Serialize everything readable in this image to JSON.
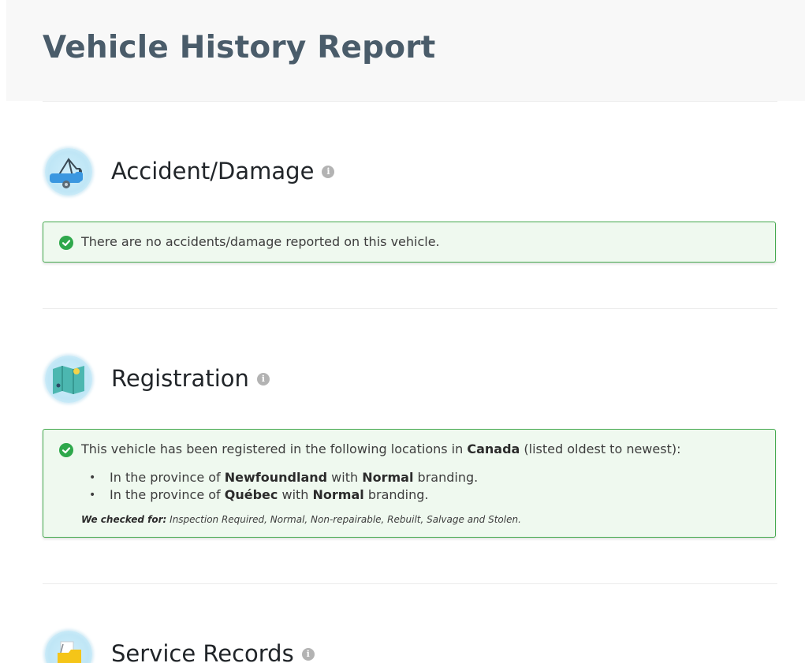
{
  "header": {
    "title": "Vehicle History Report"
  },
  "sections": {
    "accident": {
      "title": "Accident/Damage",
      "icon": "tow-truck-icon",
      "message": "There are no accidents/damage reported on this vehicle."
    },
    "registration": {
      "title": "Registration",
      "icon": "map-icon",
      "intro_prefix": "This vehicle has been registered in the following locations in ",
      "country": "Canada",
      "intro_suffix": " (listed oldest to newest):",
      "locations": [
        {
          "prefix": "In the province of ",
          "province": "Newfoundland",
          "middle": " with ",
          "branding": "Normal",
          "suffix": " branding."
        },
        {
          "prefix": "In the province of ",
          "province": "Québec",
          "middle": " with ",
          "branding": "Normal",
          "suffix": " branding."
        }
      ],
      "checked_label": "We checked for:",
      "checked_list": " Inspection Required, Normal, Non-repairable, Rebuilt, Salvage and Stolen."
    },
    "service": {
      "title": "Service Records",
      "icon": "folder-icon"
    }
  },
  "colors": {
    "title": "#4a5c6a",
    "success_border": "#43a94d",
    "success_bg": "#eff9ef",
    "check": "#2ea84b",
    "info": "#b3b3b3"
  }
}
